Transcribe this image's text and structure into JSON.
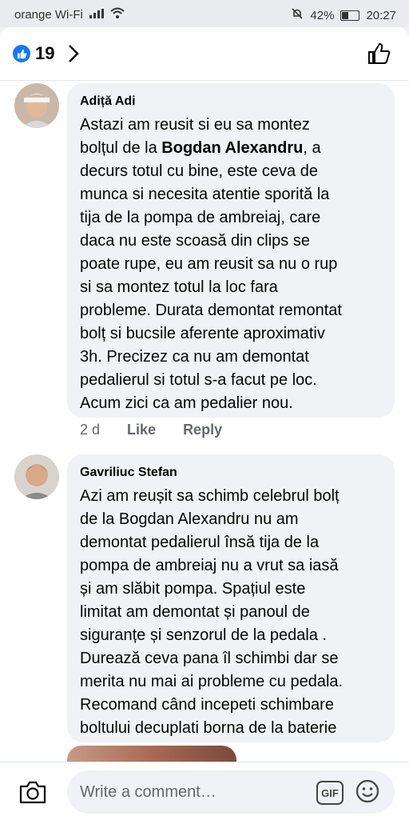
{
  "status_bar": {
    "carrier": "orange Wi-Fi",
    "battery": "42%",
    "time": "20:27"
  },
  "header": {
    "reaction_count": "19"
  },
  "comments": [
    {
      "author": "Adiță Adi",
      "text_before": "Astazi am reusit si eu sa montez\nbolțul de la ",
      "mention": "Bogdan Alexandru",
      "text_after": ", a\ndecurs totul cu bine, este ceva de\nmunca si necesita atentie sporită la\ntija de la pompa de ambreiaj, care\ndaca nu este scoasă din clips  se\npoate rupe, eu am reusit sa nu o rup\nsi sa montez totul la loc fara\nprobleme. Durata demontat remontat\nbolț si bucsile aferente aproximativ\n3h. Precizez ca nu am demontat\npedalierul si totul s-a facut pe loc.\nAcum zici ca am pedalier nou.",
      "time": "2 d",
      "like_label": "Like",
      "reply_label": "Reply"
    },
    {
      "author": "Gavriliuc Stefan",
      "text": "Azi am reușit sa schimb celebrul bolț\nde la Bogdan Alexandru  nu am\ndemontat pedalierul  însă tija de la\npompa de ambreiaj nu a vrut sa iasă\nși am slăbit pompa. Spațiul este\nlimitat am demontat și panoul de\nsiguranțe  și senzorul de la pedala .\nDurează ceva pana îl schimbi dar se\nmerita nu mai ai probleme cu pedala.\nRecomand când incepeti schimbare\nboltului decuplati borna de la baterie"
    }
  ],
  "composer": {
    "placeholder": "Write a comment…",
    "gif_label": "GIF"
  },
  "colors": {
    "accent": "#1877f2",
    "bubble": "#f0f2f5",
    "muted": "#65676b"
  }
}
